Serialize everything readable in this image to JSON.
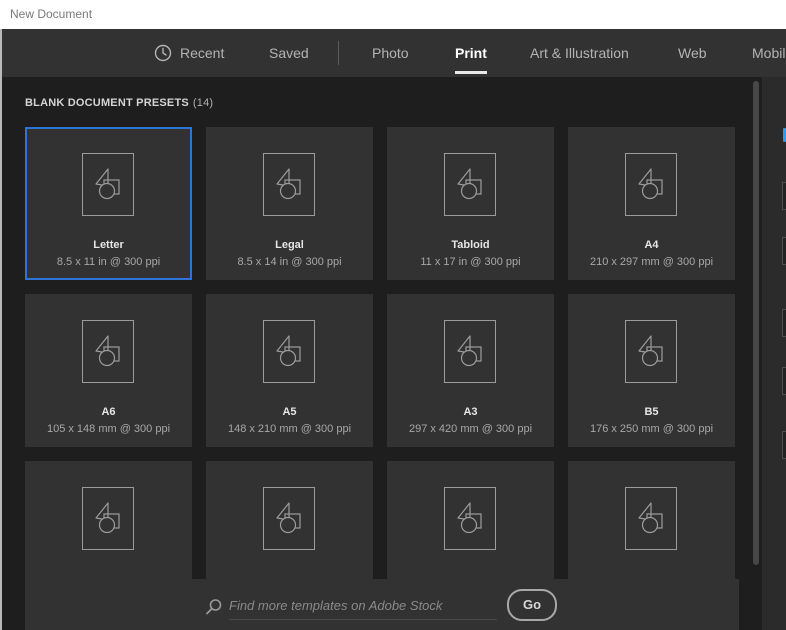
{
  "window": {
    "title": "New Document"
  },
  "tabs": [
    {
      "label": "Recent",
      "icon": "clock-icon"
    },
    {
      "label": "Saved"
    },
    {
      "label": "Photo"
    },
    {
      "label": "Print",
      "active": true
    },
    {
      "label": "Art & Illustration"
    },
    {
      "label": "Web"
    },
    {
      "label": "Mobil"
    }
  ],
  "presets": {
    "title": "BLANK DOCUMENT PRESETS",
    "count": "(14)",
    "items": [
      {
        "name": "Letter",
        "dims": "8.5 x 11 in @ 300 ppi",
        "selected": true
      },
      {
        "name": "Legal",
        "dims": "8.5 x 14 in @ 300 ppi"
      },
      {
        "name": "Tabloid",
        "dims": "11 x 17 in @ 300 ppi"
      },
      {
        "name": "A4",
        "dims": "210 x 297 mm @ 300 ppi"
      },
      {
        "name": "A6",
        "dims": "105 x 148 mm @ 300 ppi"
      },
      {
        "name": "A5",
        "dims": "148 x 210 mm @ 300 ppi"
      },
      {
        "name": "A3",
        "dims": "297 x 420 mm @ 300 ppi"
      },
      {
        "name": "B5",
        "dims": "176 x 250 mm @ 300 ppi"
      },
      {
        "name": "",
        "dims": ""
      },
      {
        "name": "",
        "dims": ""
      },
      {
        "name": "",
        "dims": ""
      },
      {
        "name": "",
        "dims": ""
      }
    ]
  },
  "search": {
    "placeholder": "Find more templates on Adobe Stock",
    "go_label": "Go"
  },
  "colors": {
    "accent": "#2d73d8",
    "panel": "#323232",
    "background": "#1e1e1e"
  }
}
